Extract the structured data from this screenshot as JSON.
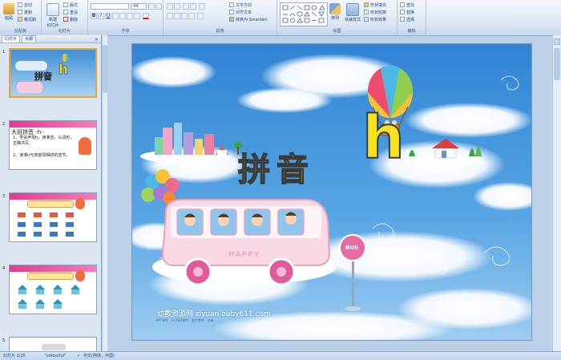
{
  "ribbon": {
    "clipboard": {
      "paste": "粘贴",
      "cut": "剪切",
      "copy": "复制",
      "format_painter": "格式刷",
      "label": "剪贴板"
    },
    "slides": {
      "new_slide": "新建\n幻灯片",
      "layout": "版式",
      "reset": "重设",
      "delete": "删除",
      "label": "幻灯片"
    },
    "font": {
      "font_size": "44",
      "label": "字体"
    },
    "paragraph": {
      "text_direction": "文字方向",
      "align_text": "对齐文本",
      "smartart": "转换为 SmartArt",
      "label": "段落"
    },
    "drawing": {
      "arrange": "排列",
      "quick_styles": "快速样式",
      "shape_fill": "形状填充",
      "shape_outline": "形状轮廓",
      "shape_effects": "形状效果",
      "label": "绘图"
    },
    "editing": {
      "find": "查找",
      "replace": "替换",
      "select": "选择",
      "label": "编辑"
    }
  },
  "panel": {
    "tabs": [
      "幻灯片",
      "大纲"
    ],
    "close": "×",
    "thumbs": [
      {
        "num": "1",
        "title": "拼音",
        "letter": "h"
      },
      {
        "num": "2",
        "title": "大班拼音 -h-",
        "lines": [
          "1、学会声母h，读准音，认清形，正确书写。",
          "2、读准h与单韵母相拼的音节。"
        ]
      },
      {
        "num": "3"
      },
      {
        "num": "4"
      },
      {
        "num": "5"
      }
    ]
  },
  "slide": {
    "title": "拼音",
    "letter": "h",
    "bus_text": "HAPPY",
    "bus_stop": "BUS",
    "brand": "幼教资源网 ziyuan.baby611.com",
    "brand_sub": "PPT课件 · FLASH课件 · 图片素材 · 试卷"
  },
  "status": {
    "slide_info": "幻灯片 1/15",
    "theme": "\"colourful\"",
    "language": "中文(简体，中国)"
  },
  "colors": {
    "ribbon_bg": "#dbe6f4",
    "selection": "#f0a12a",
    "title_fill": "#f6e31a",
    "sky": "#3a8fd8"
  }
}
